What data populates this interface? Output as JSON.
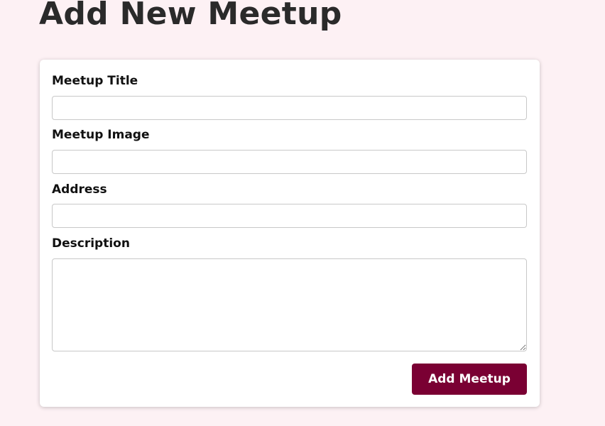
{
  "page": {
    "title": "Add New Meetup"
  },
  "form": {
    "fields": [
      {
        "label": "Meetup Title",
        "value": "",
        "placeholder": ""
      },
      {
        "label": "Meetup Image",
        "value": "",
        "placeholder": ""
      },
      {
        "label": "Address",
        "value": "",
        "placeholder": ""
      },
      {
        "label": "Description",
        "value": "",
        "placeholder": ""
      }
    ],
    "submit_label": "Add Meetup"
  },
  "colors": {
    "background": "#fdf1f4",
    "card": "#ffffff",
    "accent": "#7a0033",
    "title_text": "#2a2a2a"
  }
}
